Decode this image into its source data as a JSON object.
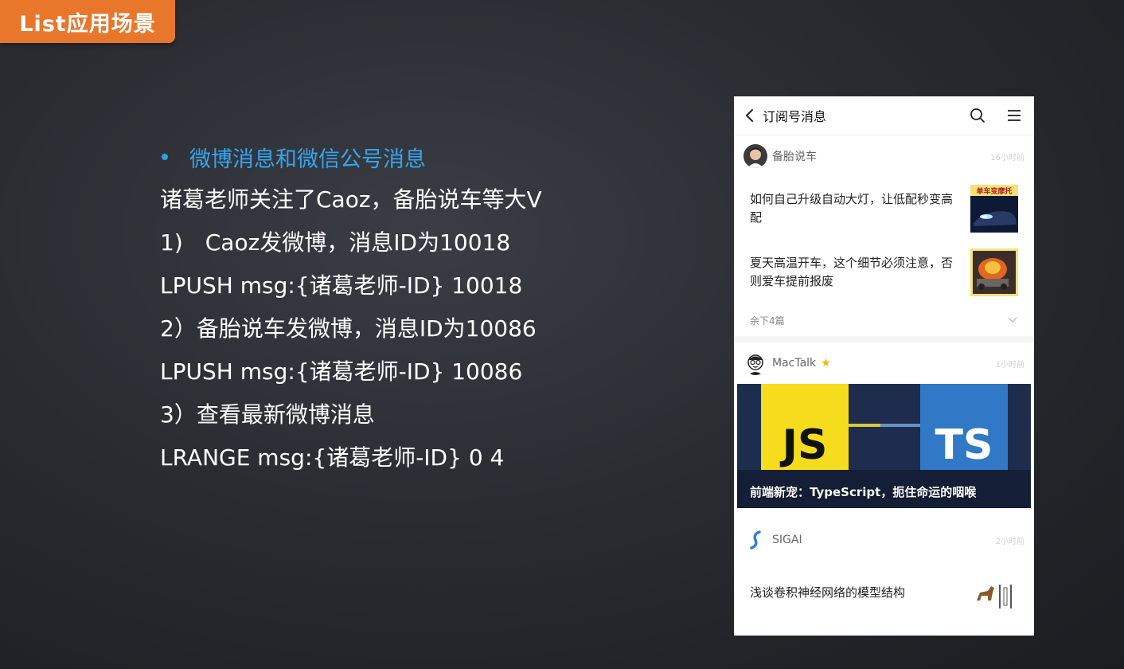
{
  "slide": {
    "tag_title": "List应用场景",
    "bullet_heading": "微博消息和微信公号消息",
    "lines": [
      "诸葛老师关注了Caoz，备胎说车等大V",
      "1)　Caoz发微博，消息ID为10018",
      "LPUSH  msg:{诸葛老师-ID}  10018",
      "2）备胎说车发微博，消息ID为10086",
      "LPUSH  msg:{诸葛老师-ID} 10086",
      "3）查看最新微博消息",
      "LRANGE  msg:{诸葛老师-ID}  0  4"
    ]
  },
  "phone": {
    "header_title": "订阅号消息",
    "accounts": [
      {
        "name": "备胎说车",
        "time": "16小时前",
        "articles": [
          {
            "title": "如何自己升级自动大灯，让低配秒变高配",
            "thumb_text": "单车变摩托"
          },
          {
            "title": "夏天高温开车，这个细节必须注意，否则爱车提前报废"
          }
        ],
        "more_label": "余下4篇"
      },
      {
        "name": "MacTalk",
        "time": "1小时前",
        "feature": {
          "caption": "前端新宠：TypeScript，扼住命运的咽喉",
          "left_text": "JS",
          "right_text": "TS"
        }
      },
      {
        "name": "SIGAI",
        "time": "2小时前",
        "articles": [
          {
            "title": "浅谈卷积神经网络的模型结构"
          }
        ]
      }
    ]
  },
  "colors": {
    "tag_bg": "#e9772b",
    "bullet_blue": "#36a5f0",
    "js_yellow": "#f5dd1e",
    "ts_blue": "#3178c6",
    "star_gold": "#f2b705"
  }
}
